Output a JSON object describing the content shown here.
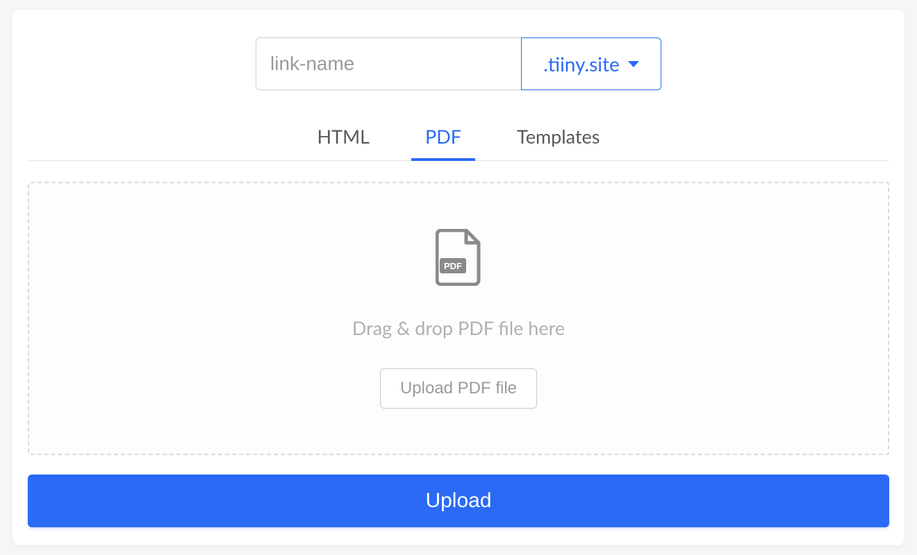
{
  "url": {
    "placeholder": "link-name",
    "value": "",
    "domain_label": ".tiiny.site"
  },
  "tabs": {
    "html": "HTML",
    "pdf": "PDF",
    "templates": "Templates"
  },
  "dropzone": {
    "hint": "Drag & drop PDF file here",
    "button_label": "Upload PDF file",
    "icon_badge": "PDF"
  },
  "upload_button": "Upload"
}
